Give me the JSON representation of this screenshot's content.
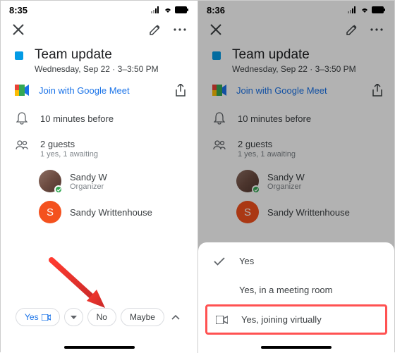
{
  "left": {
    "status_time": "8:35",
    "event_title": "Team update",
    "event_datetime": "Wednesday, Sep 22 · 3–3:50 PM",
    "meet_label": "Join with Google Meet",
    "reminder": "10 minutes before",
    "guest_count": "2 guests",
    "guest_summary": "1 yes, 1 awaiting",
    "guest1_name": "Sandy W",
    "guest1_role": "Organizer",
    "guest2_initial": "S",
    "guest2_name": "Sandy Writtenhouse",
    "rsvp_yes": "Yes",
    "rsvp_no": "No",
    "rsvp_maybe": "Maybe"
  },
  "right": {
    "status_time": "8:36",
    "event_title": "Team update",
    "event_datetime": "Wednesday, Sep 22 · 3–3:50 PM",
    "meet_label": "Join with Google Meet",
    "reminder": "10 minutes before",
    "guest_count": "2 guests",
    "guest_summary": "1 yes, 1 awaiting",
    "guest1_name": "Sandy W",
    "guest1_role": "Organizer",
    "guest2_initial": "S",
    "guest2_name": "Sandy Writtenhouse",
    "option_yes": "Yes",
    "option_room": "Yes, in a meeting room",
    "option_virtual": "Yes, joining virtually"
  }
}
